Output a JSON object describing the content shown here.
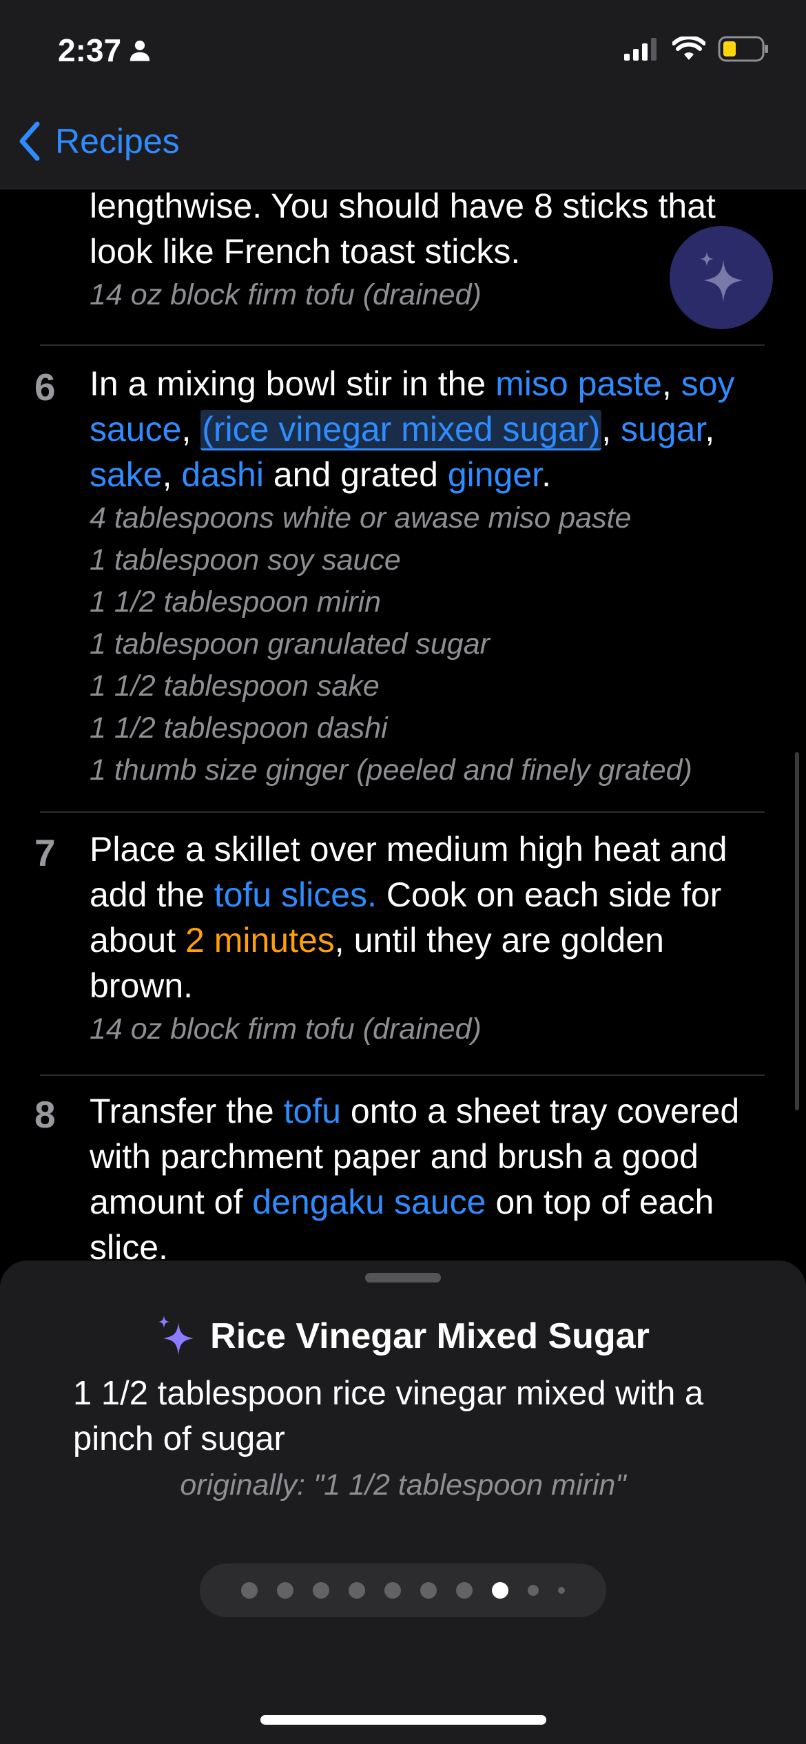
{
  "status_bar": {
    "time": "2:37"
  },
  "nav": {
    "back_label": "Recipes"
  },
  "steps": [
    {
      "number": "",
      "text_lines": [
        "lengthwise. You should have 8 sticks that",
        "look like French toast sticks."
      ],
      "ingredients": [
        "14 oz block firm tofu (drained)"
      ]
    },
    {
      "number": "6",
      "parts": {
        "t1": "In a mixing bowl stir in the ",
        "miso": "miso paste",
        "c1": ", ",
        "soy": "soy sauce",
        "c2": ", ",
        "sub": "(rice vinegar mixed sugar)",
        "c3": ", ",
        "sugar": "sugar",
        "c4": ", ",
        "sake": "sake",
        "c5": ", ",
        "dashi": "dashi",
        "t2": " and grated ",
        "ginger": "ginger",
        "t3": "."
      },
      "ingredients": [
        "4 tablespoons white or awase miso paste",
        "1 tablespoon soy sauce",
        "1 1/2 tablespoon mirin",
        "1 tablespoon granulated sugar",
        "1 1/2 tablespoon sake",
        "1 1/2 tablespoon dashi",
        "1 thumb size ginger (peeled and finely grated)"
      ]
    },
    {
      "number": "7",
      "parts": {
        "t1": "Place a skillet over medium high heat and add the ",
        "tofu": "tofu slices.",
        "t2": " Cook on each side for about ",
        "timer": "2 minutes",
        "t3": ", until they are golden brown."
      },
      "ingredients": [
        "14 oz block firm tofu (drained)"
      ]
    },
    {
      "number": "8",
      "parts": {
        "t1": "Transfer the ",
        "tofu": "tofu",
        "t2": " onto a sheet tray covered with parchment paper and brush a good amount of ",
        "sauce": "dengaku sauce",
        "t3": " on top of each slice."
      }
    }
  ],
  "sheet": {
    "title": "Rice Vinegar Mixed Sugar",
    "body": "1 1/2 tablespoon rice vinegar mixed with a pinch of sugar",
    "original": "originally: \"1 1/2 tablespoon mirin\"",
    "pager": {
      "count": 10,
      "active_index": 7
    }
  },
  "colors": {
    "link": "#2f8cff",
    "timer": "#ff9f0a",
    "sparkle": "#8a7cff",
    "battery": "#ffd60a"
  },
  "icons": [
    "person-icon",
    "signal-icon",
    "wifi-icon",
    "battery-icon",
    "chevron-left-icon",
    "sparkles-icon"
  ]
}
